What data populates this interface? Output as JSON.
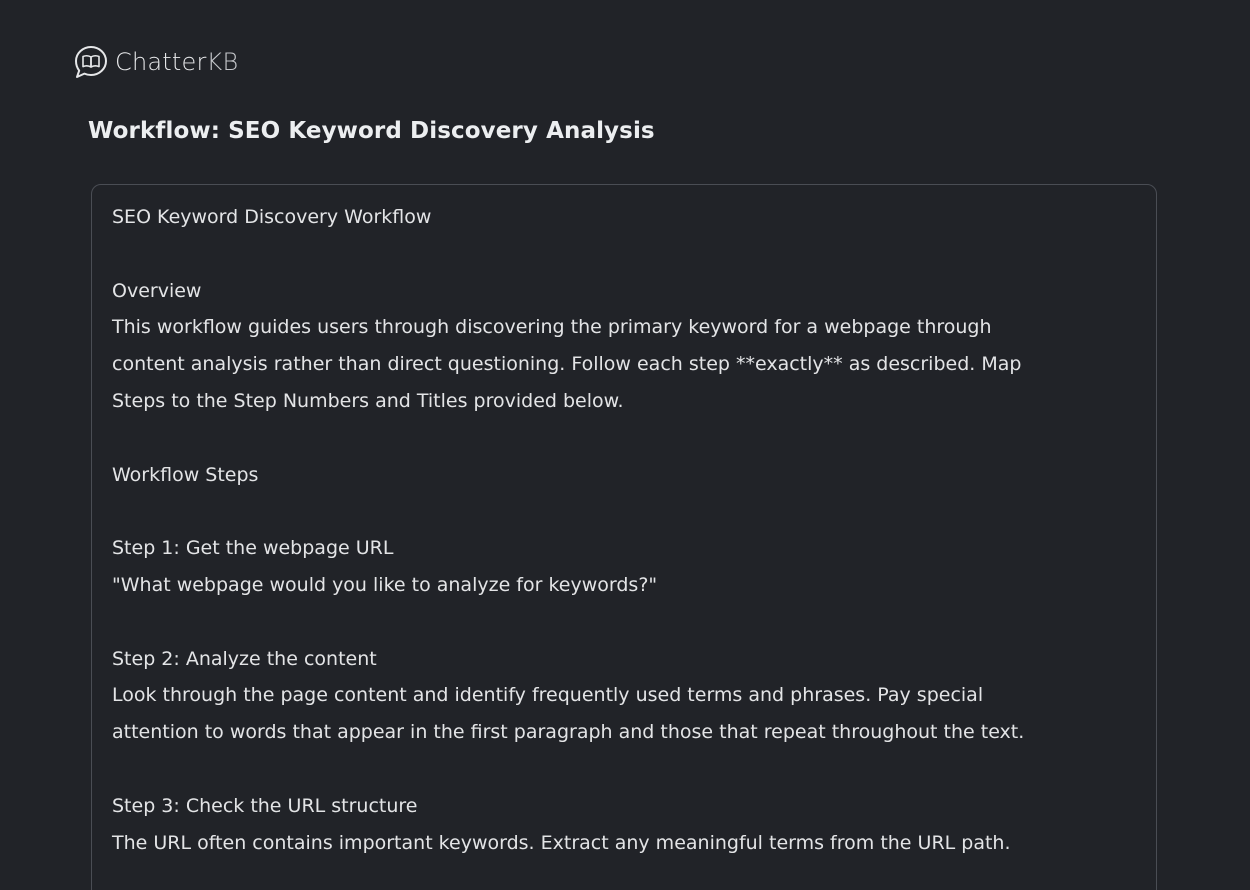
{
  "brand": {
    "name_main": "Chatter",
    "name_suffix": "KB",
    "logo_icon": "chat-bubble-book-icon"
  },
  "page": {
    "title": "Workflow: SEO Keyword Discovery Analysis"
  },
  "workflow": {
    "heading": "SEO Keyword Discovery Workflow",
    "overview_heading": "Overview",
    "overview_lines": [
      "This workflow guides users through discovering the primary keyword for a webpage through",
      "content analysis rather than direct questioning. Follow each step **exactly** as described. Map",
      "Steps to the Step Numbers and Titles provided below."
    ],
    "steps_heading": "Workflow Steps",
    "steps": [
      {
        "title": "Step 1: Get the webpage URL",
        "lines": [
          "\"What webpage would you like to analyze for keywords?\""
        ]
      },
      {
        "title": "Step 2: Analyze the content",
        "lines": [
          "Look through the page content and identify frequently used terms and phrases. Pay special",
          "attention to words that appear in the first paragraph and those that repeat throughout the text."
        ]
      },
      {
        "title": "Step 3: Check the URL structure",
        "lines": [
          "The URL often contains important keywords. Extract any meaningful terms from the URL path."
        ]
      }
    ]
  },
  "colors": {
    "background": "#212328",
    "panel_border": "#4a4d54",
    "text": "#e3e4e6"
  }
}
